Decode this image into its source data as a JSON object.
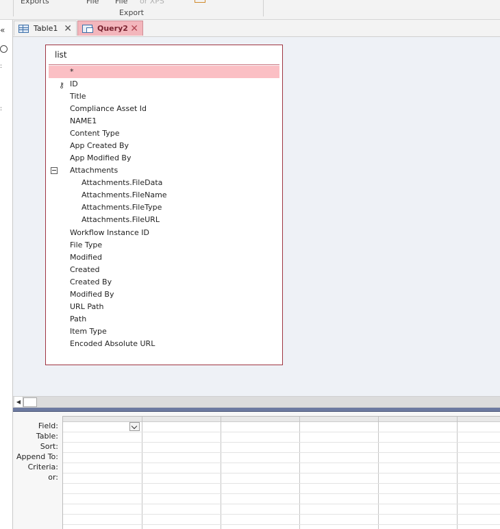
{
  "ribbon": {
    "clipped_items": [
      "Exports",
      "File",
      "File",
      "or XPS"
    ],
    "group_label": "Export"
  },
  "nav": {
    "collapse_glyph": "«"
  },
  "tabs": [
    {
      "label": "Table1",
      "icon": "table-icon",
      "active": false
    },
    {
      "label": "Query2",
      "icon": "query-icon",
      "active": true
    }
  ],
  "close_glyph": "✕",
  "table_box": {
    "title": "list",
    "fields": [
      {
        "label": "*",
        "selected": true
      },
      {
        "label": "ID",
        "key": true
      },
      {
        "label": "Title"
      },
      {
        "label": "Compliance Asset Id"
      },
      {
        "label": "NAME1"
      },
      {
        "label": "Content Type"
      },
      {
        "label": "App Created By"
      },
      {
        "label": "App Modified By"
      },
      {
        "label": "Attachments",
        "expanded": true
      },
      {
        "label": "Attachments.FileData",
        "child": true
      },
      {
        "label": "Attachments.FileName",
        "child": true
      },
      {
        "label": "Attachments.FileType",
        "child": true
      },
      {
        "label": "Attachments.FileURL",
        "child": true
      },
      {
        "label": "Workflow Instance ID"
      },
      {
        "label": "File Type"
      },
      {
        "label": "Modified"
      },
      {
        "label": "Created"
      },
      {
        "label": "Created By"
      },
      {
        "label": "Modified By"
      },
      {
        "label": "URL Path"
      },
      {
        "label": "Path"
      },
      {
        "label": "Item Type"
      },
      {
        "label": "Encoded Absolute URL"
      }
    ]
  },
  "qbe": {
    "row_labels": [
      "Field:",
      "Table:",
      "Sort:",
      "Append To:",
      "Criteria:",
      "or:"
    ]
  },
  "colors": {
    "accent": "#9e3340",
    "selected_row": "#fbbfc4",
    "active_tab": "#f3b6bc"
  }
}
